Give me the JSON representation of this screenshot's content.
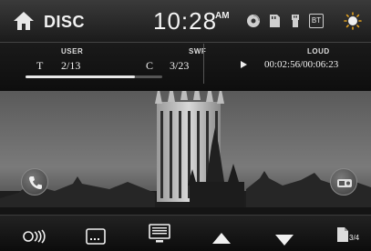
{
  "header": {
    "source_title": "DISC",
    "clock": "10:28",
    "ampm": "AM",
    "status_icons": [
      "disc-icon",
      "sd-card-icon",
      "usb-icon",
      "bluetooth-icon"
    ],
    "bt_label": "BT"
  },
  "info": {
    "user_label": "USER",
    "swf_label": "SWF",
    "loud_label": "LOUD",
    "title_glyph": "T",
    "title_value": "2/13",
    "chapter_glyph": "C",
    "chapter_value": "3/23",
    "time_elapsed_total": "00:02:56/00:06:23",
    "progress_fraction": 0.8
  },
  "footer": {
    "buttons": [
      "audio-icon",
      "subtitle-icon",
      "menu-icon",
      "up-arrow-icon",
      "down-arrow-icon",
      "page-icon"
    ],
    "page_label": "3/4"
  },
  "side_buttons": [
    "phone-icon",
    "radio-icon"
  ],
  "colors": {
    "bar_dark": "#1b1b1b",
    "text": "#f0f0f0",
    "accent_orange": "#e0a020"
  }
}
